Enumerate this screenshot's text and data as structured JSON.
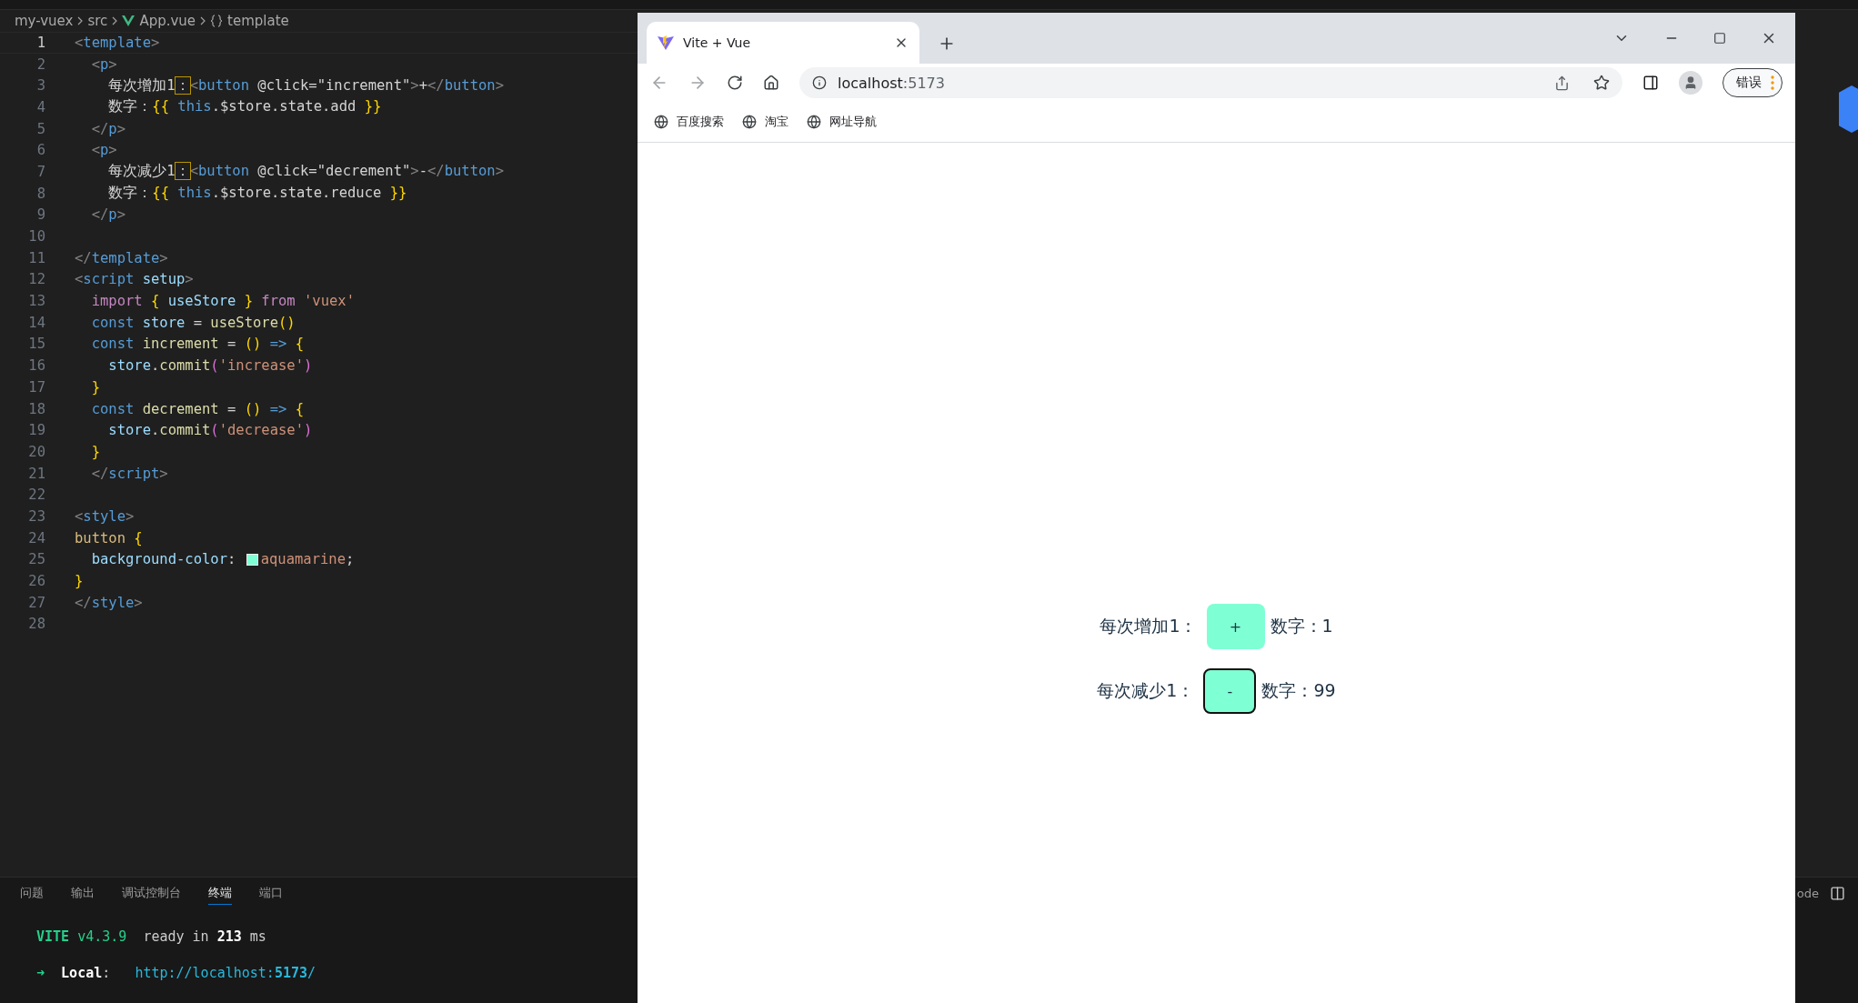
{
  "editor": {
    "breadcrumb": [
      "my-vuex",
      "src",
      "App.vue",
      "template"
    ],
    "lines": [
      {
        "number": "1",
        "current": true,
        "tokens": [
          {
            "kind": "p",
            "text": "<"
          },
          {
            "kind": "tag",
            "text": "template"
          },
          {
            "kind": "p",
            "text": ">"
          }
        ]
      },
      {
        "number": "2",
        "current": false,
        "tokens": [
          {
            "kind": "p",
            "text": "  <"
          },
          {
            "kind": "tag",
            "text": "p"
          },
          {
            "kind": "p",
            "text": ">"
          }
        ]
      },
      {
        "number": "3",
        "current": false,
        "tokens": [
          {
            "kind": "txt",
            "text": "    每次增加1"
          },
          {
            "kind": "hl",
            "text": "："
          },
          {
            "kind": "p",
            "text": "<"
          },
          {
            "kind": "tag",
            "text": "button"
          },
          {
            "kind": "txt",
            "text": " @click=\"increment\""
          },
          {
            "kind": "p",
            "text": ">"
          },
          {
            "kind": "txt",
            "text": "+"
          },
          {
            "kind": "p",
            "text": "</"
          },
          {
            "kind": "tag",
            "text": "button"
          },
          {
            "kind": "p",
            "text": ">"
          }
        ]
      },
      {
        "number": "4",
        "current": false,
        "tokens": [
          {
            "kind": "txt",
            "text": "    数字："
          },
          {
            "kind": "br",
            "text": "{{"
          },
          {
            "kind": "kw",
            "text": " this"
          },
          {
            "kind": "txt",
            "text": ".$store.state.add "
          },
          {
            "kind": "br",
            "text": "}}"
          }
        ]
      },
      {
        "number": "5",
        "current": false,
        "tokens": [
          {
            "kind": "p",
            "text": "  </"
          },
          {
            "kind": "tag",
            "text": "p"
          },
          {
            "kind": "p",
            "text": ">"
          }
        ]
      },
      {
        "number": "6",
        "current": false,
        "tokens": [
          {
            "kind": "p",
            "text": "  <"
          },
          {
            "kind": "tag",
            "text": "p"
          },
          {
            "kind": "p",
            "text": ">"
          }
        ]
      },
      {
        "number": "7",
        "current": false,
        "tokens": [
          {
            "kind": "txt",
            "text": "    每次减少1"
          },
          {
            "kind": "hl",
            "text": "："
          },
          {
            "kind": "p",
            "text": "<"
          },
          {
            "kind": "tag",
            "text": "button"
          },
          {
            "kind": "txt",
            "text": " @click=\"decrement\""
          },
          {
            "kind": "p",
            "text": ">"
          },
          {
            "kind": "txt",
            "text": "-"
          },
          {
            "kind": "p",
            "text": "</"
          },
          {
            "kind": "tag",
            "text": "button"
          },
          {
            "kind": "p",
            "text": ">"
          }
        ]
      },
      {
        "number": "8",
        "current": false,
        "tokens": [
          {
            "kind": "txt",
            "text": "    数字："
          },
          {
            "kind": "br",
            "text": "{{"
          },
          {
            "kind": "kw",
            "text": " this"
          },
          {
            "kind": "txt",
            "text": ".$store.state.reduce "
          },
          {
            "kind": "br",
            "text": "}}"
          }
        ]
      },
      {
        "number": "9",
        "current": false,
        "tokens": [
          {
            "kind": "p",
            "text": "  </"
          },
          {
            "kind": "tag",
            "text": "p"
          },
          {
            "kind": "p",
            "text": ">"
          }
        ]
      },
      {
        "number": "10",
        "current": false
      },
      {
        "number": "11",
        "current": false,
        "tokens": [
          {
            "kind": "p",
            "text": "</"
          },
          {
            "kind": "tag",
            "text": "template"
          },
          {
            "kind": "p",
            "text": ">"
          }
        ]
      },
      {
        "number": "12",
        "current": false,
        "tokens": [
          {
            "kind": "p",
            "text": "<"
          },
          {
            "kind": "tag",
            "text": "script"
          },
          {
            "kind": "var",
            "text": " setup"
          },
          {
            "kind": "p",
            "text": ">"
          }
        ]
      },
      {
        "number": "13",
        "current": false,
        "tokens": [
          {
            "kind": "ctl",
            "text": "  import"
          },
          {
            "kind": "br",
            "text": " {"
          },
          {
            "kind": "var",
            "text": " useStore "
          },
          {
            "kind": "br",
            "text": "}"
          },
          {
            "kind": "ctl",
            "text": " from"
          },
          {
            "kind": "str",
            "text": " 'vuex'"
          }
        ]
      },
      {
        "number": "14",
        "current": false,
        "tokens": [
          {
            "kind": "kw",
            "text": "  const"
          },
          {
            "kind": "var",
            "text": " store"
          },
          {
            "kind": "txt",
            "text": " = "
          },
          {
            "kind": "fn",
            "text": "useStore"
          },
          {
            "kind": "br",
            "text": "()"
          }
        ]
      },
      {
        "number": "15",
        "current": false,
        "tokens": [
          {
            "kind": "kw",
            "text": "  const"
          },
          {
            "kind": "fn",
            "text": " increment"
          },
          {
            "kind": "txt",
            "text": " = "
          },
          {
            "kind": "br",
            "text": "()"
          },
          {
            "kind": "kw",
            "text": " =>"
          },
          {
            "kind": "br",
            "text": " {"
          }
        ]
      },
      {
        "number": "16",
        "current": false,
        "tokens": [
          {
            "kind": "var",
            "text": "    store"
          },
          {
            "kind": "txt",
            "text": "."
          },
          {
            "kind": "fn",
            "text": "commit"
          },
          {
            "kind": "pk",
            "text": "("
          },
          {
            "kind": "str",
            "text": "'increase'"
          },
          {
            "kind": "pk",
            "text": ")"
          }
        ]
      },
      {
        "number": "17",
        "current": false,
        "tokens": [
          {
            "kind": "br",
            "text": "  }"
          }
        ]
      },
      {
        "number": "18",
        "current": false,
        "tokens": [
          {
            "kind": "kw",
            "text": "  const"
          },
          {
            "kind": "fn",
            "text": " decrement"
          },
          {
            "kind": "txt",
            "text": " = "
          },
          {
            "kind": "br",
            "text": "()"
          },
          {
            "kind": "kw",
            "text": " =>"
          },
          {
            "kind": "br",
            "text": " {"
          }
        ]
      },
      {
        "number": "19",
        "current": false,
        "tokens": [
          {
            "kind": "var",
            "text": "    store"
          },
          {
            "kind": "txt",
            "text": "."
          },
          {
            "kind": "fn",
            "text": "commit"
          },
          {
            "kind": "pk",
            "text": "("
          },
          {
            "kind": "str",
            "text": "'decrease'"
          },
          {
            "kind": "pk",
            "text": ")"
          }
        ]
      },
      {
        "number": "20",
        "current": false,
        "tokens": [
          {
            "kind": "br",
            "text": "  }"
          }
        ]
      },
      {
        "number": "21",
        "current": false,
        "tokens": [
          {
            "kind": "p",
            "text": "  </"
          },
          {
            "kind": "tag",
            "text": "script"
          },
          {
            "kind": "p",
            "text": ">"
          }
        ]
      },
      {
        "number": "22",
        "current": false
      },
      {
        "number": "23",
        "current": false,
        "tokens": [
          {
            "kind": "p",
            "text": "<"
          },
          {
            "kind": "tag",
            "text": "style"
          },
          {
            "kind": "p",
            "text": ">"
          }
        ]
      },
      {
        "number": "24",
        "current": false,
        "tokens": [
          {
            "kind": "sel",
            "text": "button"
          },
          {
            "kind": "br",
            "text": " {"
          }
        ]
      },
      {
        "number": "25",
        "current": false,
        "tokens": [
          {
            "kind": "var",
            "text": "  background-color"
          },
          {
            "kind": "txt",
            "text": ": "
          },
          {
            "kind": "swatch",
            "color": "#7fffd4"
          },
          {
            "kind": "str",
            "text": "aquamarine"
          },
          {
            "kind": "txt",
            "text": ";"
          }
        ]
      },
      {
        "number": "26",
        "current": false,
        "tokens": [
          {
            "kind": "br",
            "text": "}"
          }
        ]
      },
      {
        "number": "27",
        "current": false,
        "tokens": [
          {
            "kind": "p",
            "text": "</"
          },
          {
            "kind": "tag",
            "text": "style"
          },
          {
            "kind": "p",
            "text": ">"
          }
        ]
      },
      {
        "number": "28",
        "current": false
      }
    ]
  },
  "panel": {
    "tabs": [
      {
        "label": "问题",
        "selected": false
      },
      {
        "label": "输出",
        "selected": false
      },
      {
        "label": "调试控制台",
        "selected": false
      },
      {
        "label": "终端",
        "selected": true
      },
      {
        "label": "端口",
        "selected": false
      }
    ],
    "terminal": [
      [
        {
          "kind": "vite",
          "text": "VITE"
        },
        {
          "kind": "green",
          "text": " v4.3.9"
        },
        {
          "kind": "txt",
          "text": "  ready in "
        },
        {
          "kind": "bold",
          "text": "213"
        },
        {
          "kind": "txt",
          "text": " ms"
        }
      ],
      [
        {
          "kind": "green",
          "text": "➜"
        },
        {
          "kind": "bold",
          "text": "  Local"
        },
        {
          "kind": "txt",
          "text": ":   "
        },
        {
          "kind": "link",
          "text": "http://localhost:"
        },
        {
          "kind": "linkbold",
          "text": "5173"
        },
        {
          "kind": "link",
          "text": "/"
        }
      ]
    ],
    "right_label": "ode"
  },
  "browser": {
    "tab_title": "Vite + Vue",
    "url_host": "localhost",
    "url_port": ":5173",
    "profile_button": "错误",
    "bookmarks": [
      "百度搜索",
      "淘宝",
      "网址导航"
    ],
    "rows": [
      {
        "label": "每次增加1：",
        "button": "+",
        "focused": false,
        "value": "数字：1"
      },
      {
        "label": "每次减少1：",
        "button": "-",
        "focused": true,
        "value": "数字：99"
      }
    ]
  }
}
